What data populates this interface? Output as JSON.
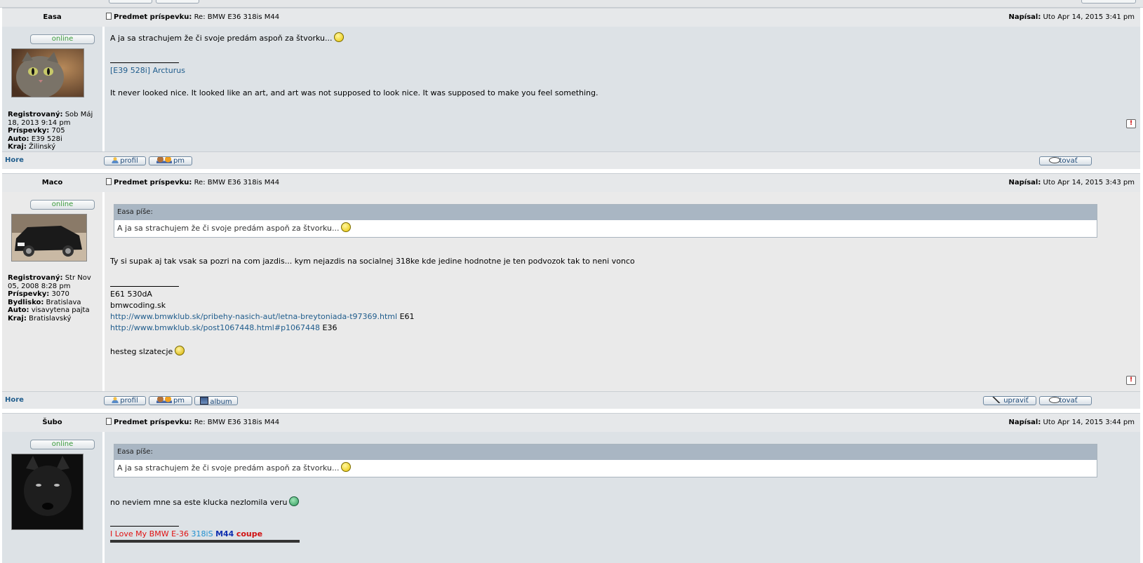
{
  "posts": [
    {
      "author": "Easa",
      "subject_label": "Predmet príspevku:",
      "subject": "Re: BMW E36 318is M44",
      "date_label": "Napísal:",
      "date": "Uto Apr 14, 2015 3:41 pm",
      "status": "online",
      "registered_label": "Registrovaný:",
      "registered": "Sob Máj 18, 2013 9:14 pm",
      "posts_label": "Príspevky:",
      "posts_count": "705",
      "car_label": "Auto:",
      "car": "E39 528i",
      "region_label": "Kraj:",
      "region": "Žilinský",
      "text": "A ja sa strachujem že či svoje predám aspoň za štvorku...",
      "sig_link": "[E39 528i] Arcturus",
      "sig_quote": "It never looked nice. It looked like an art, and art was not supposed to look nice. It was supposed to make you feel something."
    },
    {
      "author": "Maco",
      "subject_label": "Predmet príspevku:",
      "subject": "Re: BMW E36 318is M44",
      "date_label": "Napísal:",
      "date": "Uto Apr 14, 2015 3:43 pm",
      "status": "online",
      "registered_label": "Registrovaný:",
      "registered": "Str Nov 05, 2008 8:28 pm",
      "posts_label": "Príspevky:",
      "posts_count": "3070",
      "residence_label": "Bydlisko:",
      "residence": "Bratislava",
      "car_label": "Auto:",
      "car": "visavytena pajta",
      "region_label": "Kraj:",
      "region": "Bratislavský",
      "quote_header": "Easa píše:",
      "quote_text": "A ja sa strachujem že či svoje predám aspoň za štvorku...",
      "text": "Ty si supak aj tak vsak sa pozri na com jazdis... kym nejazdis na socialnej 318ke kde jedine hodnotne je ten podvozok tak to neni vonco",
      "sig1": "E61 530dA",
      "sig2": "bmwcoding.sk",
      "sig_link1": "http://www.bmwklub.sk/pribehy-nasich-aut/letna-breytoniada-t97369.html",
      "sig_link1_suffix": "E61",
      "sig_link2": "http://www.bmwklub.sk/post1067448.html#p1067448",
      "sig_link2_suffix": "E36",
      "sig3": "hesteg slzatecje"
    },
    {
      "author": "Šubo",
      "subject_label": "Predmet príspevku:",
      "subject": "Re: BMW E36 318is M44",
      "date_label": "Napísal:",
      "date": "Uto Apr 14, 2015 3:44 pm",
      "status": "online",
      "quote_header": "Easa píše:",
      "quote_text": "A ja sa strachujem že či svoje predám aspoň za štvorku...",
      "text": "no neviem mne sa este klucka nezlomila veru",
      "sig_part1": "I Love My BMW E-36",
      "sig_part2": "318iS",
      "sig_part3": "M44",
      "sig_part4": "coupe"
    }
  ],
  "buttons": {
    "hore": "Hore",
    "profil": "profil",
    "pm": "pm",
    "album": "album",
    "upravit": "upraviť",
    "citovat": "citovať",
    "report": "!"
  },
  "colors": {
    "link": "#1f5c8c",
    "online": "#3a9a3a",
    "sig_red": "#e01010",
    "sig_orange": "#ff6a00",
    "sig_blue": "#1f8fd0",
    "sig_navy": "#1030b0"
  }
}
